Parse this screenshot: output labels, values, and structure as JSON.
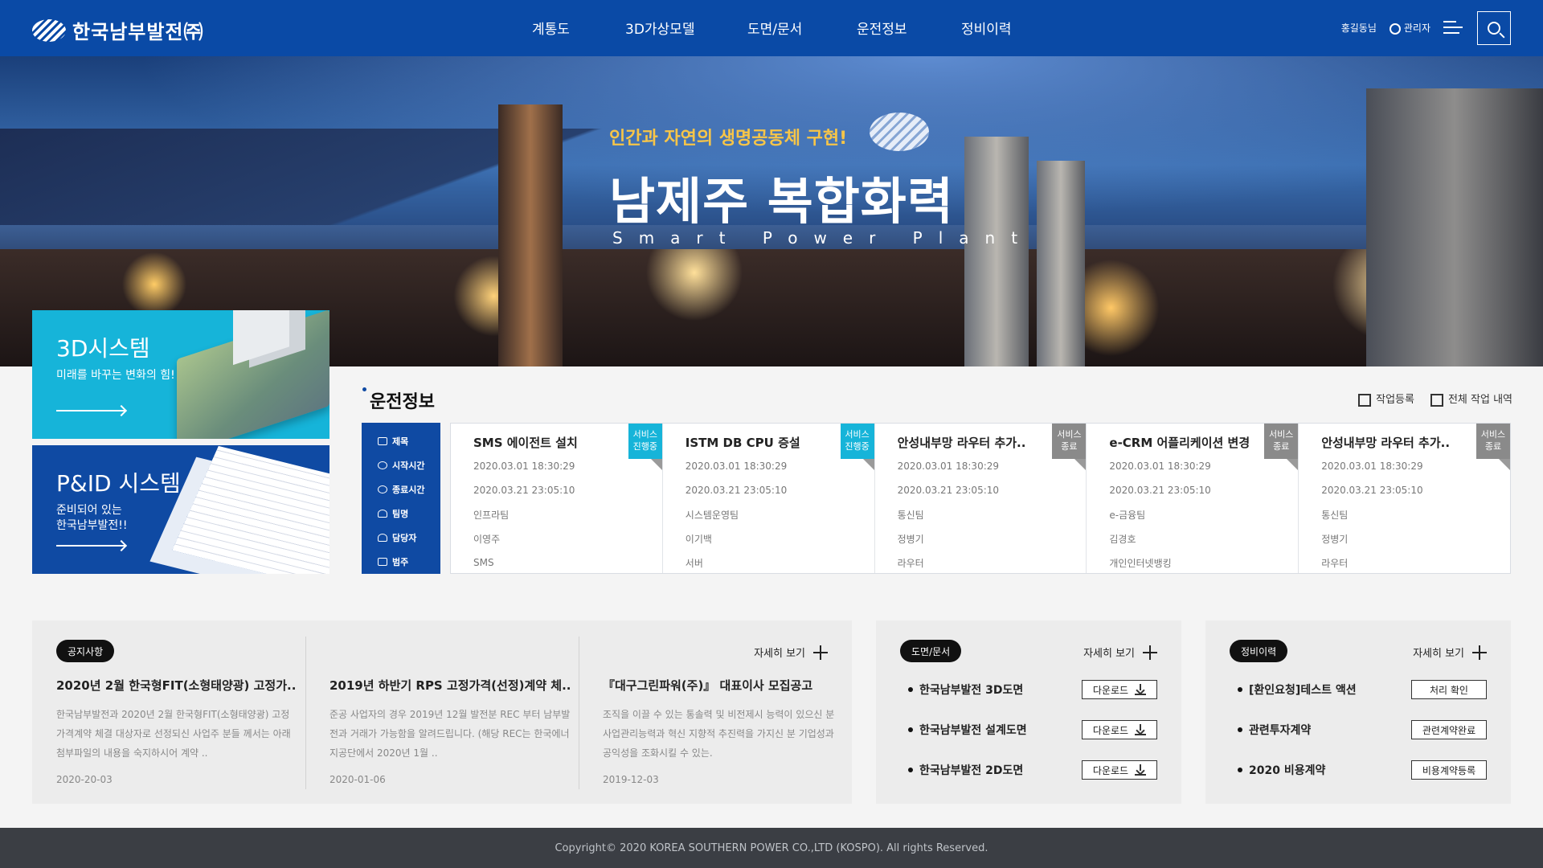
{
  "header": {
    "logo_text": "한국남부발전㈜",
    "nav": [
      "계통도",
      "3D가상모델",
      "도면/문서",
      "운전정보",
      "정비이력"
    ],
    "user": "홍길동님",
    "admin": "관리자"
  },
  "hero": {
    "slogan": "인간과 자연의 생명공동체 구현!",
    "title": "남제주 복합화력",
    "subtitle": "Smart Power Plant"
  },
  "systems": [
    {
      "title": "3D시스템",
      "desc": "미래를 바꾸는 변화의 힘!"
    },
    {
      "title": "P&ID 시스템",
      "desc": "준비되어 있는\n한국남부발전!!"
    }
  ],
  "operation": {
    "title": "운전정보",
    "actions": [
      "작업등록",
      "전체 작업 내역"
    ],
    "labels": [
      "제목",
      "시작시간",
      "종료시간",
      "팀명",
      "담당자",
      "범주"
    ],
    "items": [
      {
        "title": "SMS 에이전트 설치",
        "start": "2020.03.01 18:30:29",
        "end": "2020.03.21 23:05:10",
        "team": "인프라팀",
        "manager": "이영주",
        "category": "SMS",
        "status": "서비스\n진행중",
        "state": "run"
      },
      {
        "title": "ISTM DB CPU 증설",
        "start": "2020.03.01 18:30:29",
        "end": "2020.03.21 23:05:10",
        "team": "시스템운영팀",
        "manager": "이기백",
        "category": "서버",
        "status": "서비스\n진행중",
        "state": "run"
      },
      {
        "title": "안성내부망 라우터 추가..",
        "start": "2020.03.01 18:30:29",
        "end": "2020.03.21 23:05:10",
        "team": "통신팀",
        "manager": "정병기",
        "category": "라우터",
        "status": "서비스\n종료",
        "state": "end"
      },
      {
        "title": "e-CRM 어플리케이션 변경",
        "start": "2020.03.01 18:30:29",
        "end": "2020.03.21 23:05:10",
        "team": "e-금융팀",
        "manager": "김경호",
        "category": "개인인터넷뱅킹",
        "status": "서비스\n종료",
        "state": "end"
      },
      {
        "title": "안성내부망 라우터 추가..",
        "start": "2020.03.01 18:30:29",
        "end": "2020.03.21 23:05:10",
        "team": "통신팀",
        "manager": "정병기",
        "category": "라우터",
        "status": "서비스\n종료",
        "state": "end"
      }
    ]
  },
  "notice": {
    "label": "공지사항",
    "more": "자세히 보기",
    "items": [
      {
        "title": "2020년 2월 한국형FIT(소형태양광) 고정가..",
        "body": "한국남부발전과 2020년 2월 한국형FIT(소형태양광) 고정 가격계약 체결 대상자로 선정되신 사업주 분들 께서는 아래 첨부파일의 내용을 숙지하시어 계약 ..",
        "date": "2020-20-03"
      },
      {
        "title": "2019년 하반기 RPS 고정가격(선정)계약 체..",
        "body": "준공 사업자의 경우 2019년 12월 발전분 REC 부터 남부발전과 거래가 가능함을 알려드립니다. (해당 REC는 한국에너지공단에서 2020년 1월 ..",
        "date": "2020-01-06"
      },
      {
        "title": "『대구그린파워(주)』 대표이사 모집공고",
        "body": "조직을 이끌 수 있는 통솔력 및 비전제시 능력이 있으신 분 사업관리능력과 혁신 지향적 추진력을 가지신 분 기업성과 공익성을 조화시킬 수 있는.",
        "date": "2019-12-03"
      }
    ]
  },
  "drawings": {
    "label": "도면/문서",
    "more": "자세히 보기",
    "button": "다운로드",
    "items": [
      "한국남부발전 3D도면",
      "한국남부발전 설계도면",
      "한국남부발전 2D도면"
    ]
  },
  "maintenance": {
    "label": "정비이력",
    "more": "자세히 보기",
    "items": [
      {
        "name": "[환인요청]테스트 액션",
        "button": "처리 확인"
      },
      {
        "name": "관련투자계약",
        "button": "관련계약완료"
      },
      {
        "name": "2020 비용계약",
        "button": "비용계약등록"
      }
    ]
  },
  "footer": {
    "copyright": "Copyright© 2020 KOREA SOUTHERN POWER CO.,LTD (KOSPO). All rights Reserved."
  },
  "colors": {
    "primary": "#0a4aa6",
    "accent_cyan": "#16b4d9",
    "slogan_gold": "#f7c548",
    "footer_bg": "#3b3e44"
  }
}
